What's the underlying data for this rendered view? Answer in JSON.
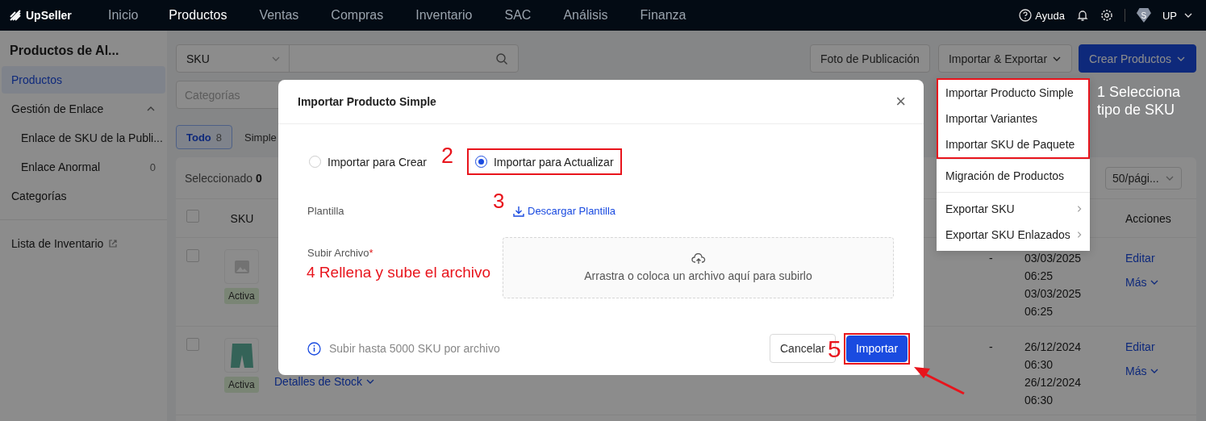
{
  "topbar": {
    "logo": "UpSeller",
    "nav": [
      {
        "label": "Inicio",
        "selected": false
      },
      {
        "label": "Productos",
        "selected": true
      },
      {
        "label": "Ventas",
        "selected": false
      },
      {
        "label": "Compras",
        "selected": false
      },
      {
        "label": "Inventario",
        "selected": false
      },
      {
        "label": "SAC",
        "selected": false
      },
      {
        "label": "Análisis",
        "selected": false
      },
      {
        "label": "Finanza",
        "selected": false
      }
    ],
    "help": "Ayuda",
    "avatar_letter": "S",
    "user": "UP"
  },
  "sidebar": {
    "title": "Productos de Al...",
    "items": [
      {
        "label": "Productos",
        "selected": true
      },
      {
        "label": "Gestión de Enlace",
        "selected": false,
        "expanded": true,
        "children": [
          {
            "label": "Enlace de SKU de la Publi...",
            "selected": false
          },
          {
            "label": "Enlace Anormal",
            "count": "0",
            "selected": false
          }
        ]
      },
      {
        "label": "Categorías",
        "selected": false
      },
      {
        "label": "Lista de Inventario",
        "selected": false,
        "external": true
      }
    ]
  },
  "filters": {
    "search_type": "SKU",
    "categories_placeholder": "Categorías"
  },
  "actions": [
    "Foto de Publicación",
    "Importar & Exportar",
    "Crear Productos"
  ],
  "tabs": [
    {
      "label": "Todo",
      "count": "8",
      "selected": true
    },
    {
      "label": "Simple",
      "selected": false
    }
  ],
  "table": {
    "selected_text": "Seleccionado",
    "selected_count": "0",
    "page_size": "50/pági...",
    "select_all_checked": false,
    "columns": [
      "SKU",
      "Acciones"
    ],
    "rows": [
      {
        "kind": "no-image",
        "checked": false,
        "status": "Activa",
        "dash": "-",
        "dates": [
          "03/03/2025",
          "06:25",
          "03/03/2025",
          "06:25"
        ],
        "edit": "Editar",
        "more": "Más"
      },
      {
        "kind": "photo",
        "checked": false,
        "status": "Activa",
        "link": "Detalles de Stock",
        "dash": "-",
        "dates": [
          "26/12/2024",
          "06:30",
          "26/12/2024",
          "06:30"
        ],
        "edit": "Editar",
        "more": "Más"
      }
    ]
  },
  "menu": {
    "groups": [
      {
        "highlighted": true,
        "items": [
          {
            "label": "Importar Producto Simple",
            "submenu": false
          },
          {
            "label": "Importar Variantes",
            "submenu": false
          },
          {
            "label": "Importar SKU de Paquete",
            "submenu": false
          }
        ]
      },
      {
        "highlighted": false,
        "items": [
          {
            "label": "Migración de Productos",
            "submenu": false
          }
        ]
      },
      {
        "highlighted": false,
        "items": [
          {
            "label": "Exportar SKU",
            "submenu": true
          },
          {
            "label": "Exportar SKU Enlazados",
            "submenu": true
          }
        ]
      }
    ]
  },
  "dialog": {
    "title": "Importar Producto Simple",
    "close": "×",
    "modes": [
      {
        "label": "Importar para Crear",
        "selected": false,
        "highlighted": false
      },
      {
        "label": "Importar para Actualizar",
        "selected": true,
        "highlighted": true
      }
    ],
    "template_label": "Plantilla",
    "template_link": "Descargar Plantilla",
    "upload_label": "Subir Archivo",
    "required_mark": "*",
    "drop_text": "Arrastra o coloca un archivo aquí para subirlo",
    "note": "Subir hasta 5000 SKU por archivo",
    "cancel": "Cancelar",
    "submit": "Importar",
    "submit_highlighted": true
  },
  "annotations": [
    "1 Selecciona tipo de SKU",
    "2",
    "3",
    "4 Rellena y sube el archivo",
    "5"
  ]
}
